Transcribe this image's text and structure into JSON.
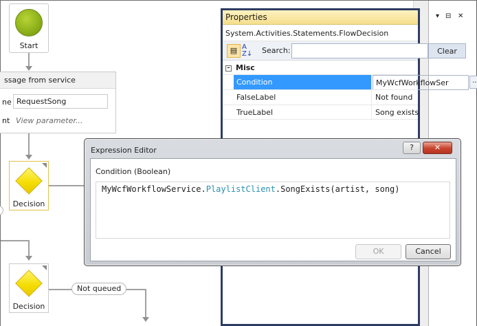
{
  "designer": {
    "start_label": "Start",
    "receive": {
      "title": "ssage from service",
      "op_label": "ne",
      "op_value": "RequestSong",
      "content_label": "nt",
      "content_link": "View parameter..."
    },
    "decision1_label": "Decision",
    "decision2_label": "Decision",
    "not_queued_label": "Not queued"
  },
  "properties": {
    "title": "Properties",
    "title_buttons": [
      "▾",
      "⊟",
      "✕"
    ],
    "type_name": "System.Activities.Statements.FlowDecision",
    "search_label": "Search:",
    "search_value": "",
    "clear_label": "Clear",
    "category": "Misc",
    "rows": [
      {
        "name": "Condition",
        "value": "MyWcfWorkflowSer",
        "selected": true
      },
      {
        "name": "FalseLabel",
        "value": "Not found",
        "selected": false
      },
      {
        "name": "TrueLabel",
        "value": "Song exists",
        "selected": false
      }
    ],
    "ellipsis_label": "..."
  },
  "dialog": {
    "title": "Expression Editor",
    "help_label": "?",
    "close_label": "✕",
    "sublabel": "Condition (Boolean)",
    "expression": {
      "part1": "MyWcfWorkflowService.",
      "part2": "PlaylistClient",
      "part3": ".SongExists(artist, song)"
    },
    "ok_label": "OK",
    "cancel_label": "Cancel"
  },
  "colors": {
    "selection": "#3399ff",
    "type_token": "#2b91af",
    "window_border": "#2d3d62"
  }
}
